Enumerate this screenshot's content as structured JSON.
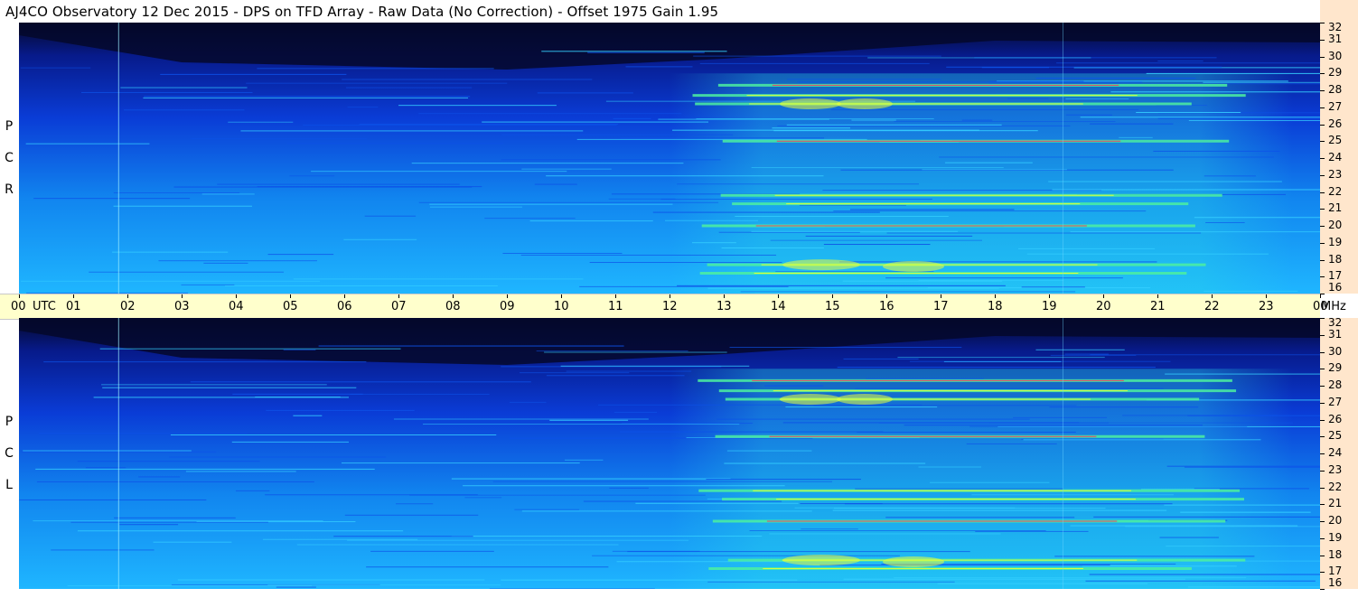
{
  "title": "AJ4CO Observatory  12 Dec 2015  -  DPS on TFD Array  -  Raw Data (No Correction)  -  Offset 1975  Gain 1.95",
  "colors": {
    "background": "#ffffff",
    "time_axis_bg": "#ffffcc",
    "freq_axis_bg": "#ffe6cc",
    "low_intensity": "#05082a",
    "mid_intensity": "#0a3cd6",
    "high_intensity": "#1fb6ff",
    "burst_green": "#4cf0a0",
    "burst_yellow": "#e8ff3a",
    "burst_red": "#ff3060"
  },
  "chart_data": {
    "type": "heatmap",
    "title": "AJ4CO Observatory  12 Dec 2015  -  DPS on TFD Array  -  Raw Data (No Correction)  -  Offset 1975  Gain 1.95",
    "xlabel": "UTC",
    "ylabel": "MHz",
    "x_range_utc_hours": [
      0,
      24
    ],
    "y_range_mhz": [
      16,
      32
    ],
    "x_tick_labels": [
      "00",
      "01",
      "02",
      "03",
      "04",
      "05",
      "06",
      "07",
      "08",
      "09",
      "10",
      "11",
      "12",
      "13",
      "14",
      "15",
      "16",
      "17",
      "18",
      "19",
      "20",
      "21",
      "22",
      "23",
      "00"
    ],
    "x_unit_label": "UTC",
    "y_unit_label": "MHz",
    "y_tick_labels": [
      "32",
      "31",
      "30",
      "29",
      "28",
      "27",
      "26",
      "25",
      "24",
      "23",
      "22",
      "21",
      "20",
      "19",
      "18",
      "17",
      "16"
    ],
    "panels": [
      {
        "name": "RCP",
        "label_letters": [
          "R",
          "C",
          "P"
        ],
        "interference_bands_mhz": [
          28.3,
          27.7,
          27.2,
          25.0,
          21.8,
          21.3,
          20.0,
          17.7,
          17.2
        ],
        "active_hours_utc": [
          12,
          23.5
        ]
      },
      {
        "name": "LCP",
        "label_letters": [
          "L",
          "C",
          "P"
        ],
        "interference_bands_mhz": [
          28.3,
          27.7,
          27.2,
          25.0,
          21.8,
          21.3,
          20.0,
          17.7,
          17.2
        ],
        "active_hours_utc": [
          12,
          23.5
        ]
      }
    ],
    "grid": false,
    "legend": "none"
  }
}
